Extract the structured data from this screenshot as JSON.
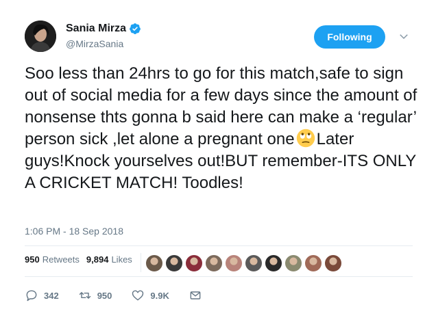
{
  "user": {
    "display_name": "Sania Mirza",
    "handle": "@MirzaSania"
  },
  "follow_button": {
    "label": "Following"
  },
  "tweet": {
    "text_part1": "Soo less than 24hrs to go for this match,safe to sign out of social media for a few days since the amount of nonsense thts gonna b said here can make a ‘regular’ person sick ,let alone a pregnant one",
    "emoji": "eye-roll-emoji",
    "text_part2": "Later guys!Knock yourselves out!BUT remember-ITS ONLY A CRICKET MATCH! Toodles!",
    "timestamp": "1:06 PM - 18 Sep 2018"
  },
  "stats": {
    "retweets_count": "950",
    "retweets_label": "Retweets",
    "likes_count": "9,894",
    "likes_label": "Likes"
  },
  "likers_avatars": [
    "#6b5a4a",
    "#3a3a3a",
    "#8a2d3a",
    "#7c6a5c",
    "#b8837a",
    "#5a5a5a",
    "#2a2a2a",
    "#8a8a70",
    "#a06a58",
    "#7a4a3a"
  ],
  "actions": {
    "reply_count": "342",
    "retweet_count": "950",
    "like_count": "9.9K"
  },
  "colors": {
    "accent": "#1da1f2",
    "secondary_text": "#657786"
  }
}
